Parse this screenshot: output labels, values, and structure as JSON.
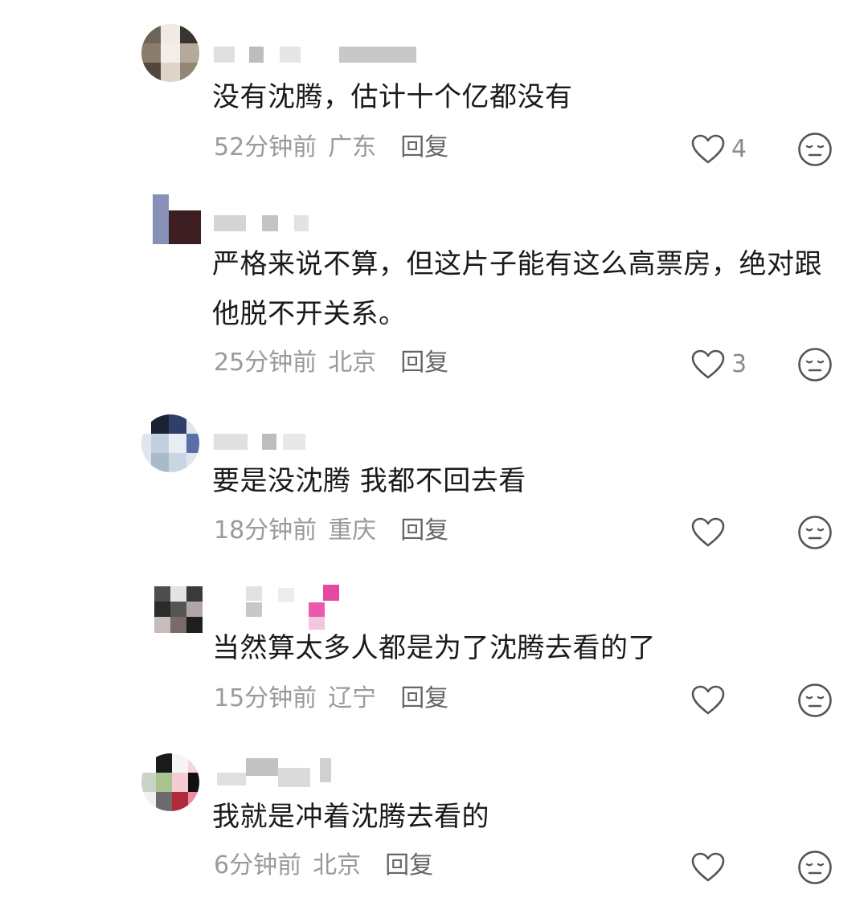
{
  "comments": [
    {
      "text": "没有沈腾，估计十个亿都没有",
      "time": "52分钟前",
      "location": "广东",
      "reply_label": "回复",
      "likes": "4"
    },
    {
      "text": "严格来说不算，但这片子能有这么高票房，绝对跟他脱不开关系。",
      "time": "25分钟前",
      "location": "北京",
      "reply_label": "回复",
      "likes": "3"
    },
    {
      "text": "要是没沈腾 我都不回去看",
      "time": "18分钟前",
      "location": "重庆",
      "reply_label": "回复",
      "likes": ""
    },
    {
      "text": "当然算太多人都是为了沈腾去看的了",
      "time": "15分钟前",
      "location": "辽宁",
      "reply_label": "回复",
      "likes": ""
    },
    {
      "text": "我就是冲着沈腾去看的",
      "time": "6分钟前",
      "location": "北京",
      "reply_label": "回复",
      "likes": ""
    }
  ],
  "icons": {
    "like": "heart-outline-icon",
    "dislike": "meh-face-icon"
  },
  "colors": {
    "text": "#1a1a1a",
    "meta": "#9a9a9a",
    "icon": "#555555"
  }
}
